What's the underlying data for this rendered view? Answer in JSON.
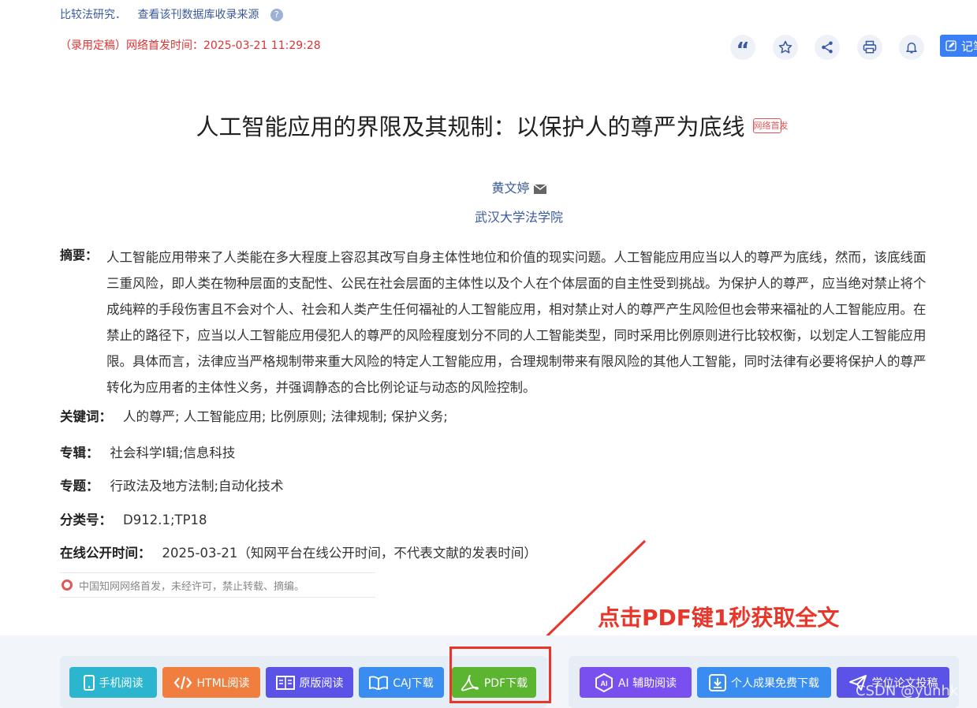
{
  "top_links": {
    "source_link": "比较法研究．",
    "db_link": "查看该刊数据库收录来源",
    "help": "?"
  },
  "publish_notice": "（录用定稿）网络首发时间：2025-03-21 11:29:28",
  "toolbar": {
    "note_label": "记笔"
  },
  "title": "人工智能应用的界限及其规制：以保护人的尊严为底线",
  "title_badge": "网络首发",
  "author": "黄文婷",
  "organization": "武汉大学法学院",
  "abstract": {
    "label": "摘要：",
    "lines": [
      "人工智能应用带来了人类能在多大程度上容忍其改写自身主体性地位和价值的现实问题。人工智能应用应当以人的尊严为底线，然而，该底线面",
      "三重风险，即人类在物种层面的支配性、公民在社会层面的主体性以及个人在个体层面的自主性受到挑战。为保护人的尊严，应当绝对禁止将个",
      "成纯粹的手段伤害且不会对个人、社会和人类产生任何福祉的人工智能应用，相对禁止对人的尊严产生风险但也会带来福祉的人工智能应用。在",
      "禁止的路径下，应当以人工智能应用侵犯人的尊严的风险程度划分不同的人工智能类型，同时采用比例原则进行比较权衡，以划定人工智能应用",
      "限。具体而言，法律应当严格规制带来重大风险的特定人工智能应用，合理规制带来有限风险的其他人工智能，同时法律有必要将保护人的尊严",
      "转化为应用者的主体性义务，并强调静态的合比例论证与动态的风险控制。"
    ]
  },
  "keywords": {
    "label": "关键词：",
    "items": [
      "人的尊严;",
      "人工智能应用;",
      "比例原则;",
      "法律规制;",
      "保护义务;"
    ]
  },
  "series": {
    "label": "专辑：",
    "value": "社会科学Ⅰ辑;信息科技"
  },
  "topic": {
    "label": "专题：",
    "value": "行政法及地方法制;自动化技术"
  },
  "classification": {
    "label": "分类号：",
    "value": "D912.1;TP18"
  },
  "online_date": {
    "label": "在线公开时间：",
    "value": "2025-03-21（知网平台在线公开时间，不代表文献的发表时间）"
  },
  "copyright_notice": "中国知网网络首发，未经许可，禁止转载、摘编。",
  "buttons": {
    "mobile": "手机阅读",
    "html": "HTML阅读",
    "original": "原版阅读",
    "caj": "CAJ下载",
    "pdf": "PDF下载",
    "ai": "AI 辅助阅读",
    "personal": "个人成果免费下载",
    "thesis": "学位论文投稿"
  },
  "annotation": "点击PDF键1秒获取全文",
  "watermark": "CSDN @yunhk",
  "colors": {
    "accent": "#3a7ff6",
    "pdf_green": "#5cb531",
    "annotation_red": "#e8362b"
  }
}
